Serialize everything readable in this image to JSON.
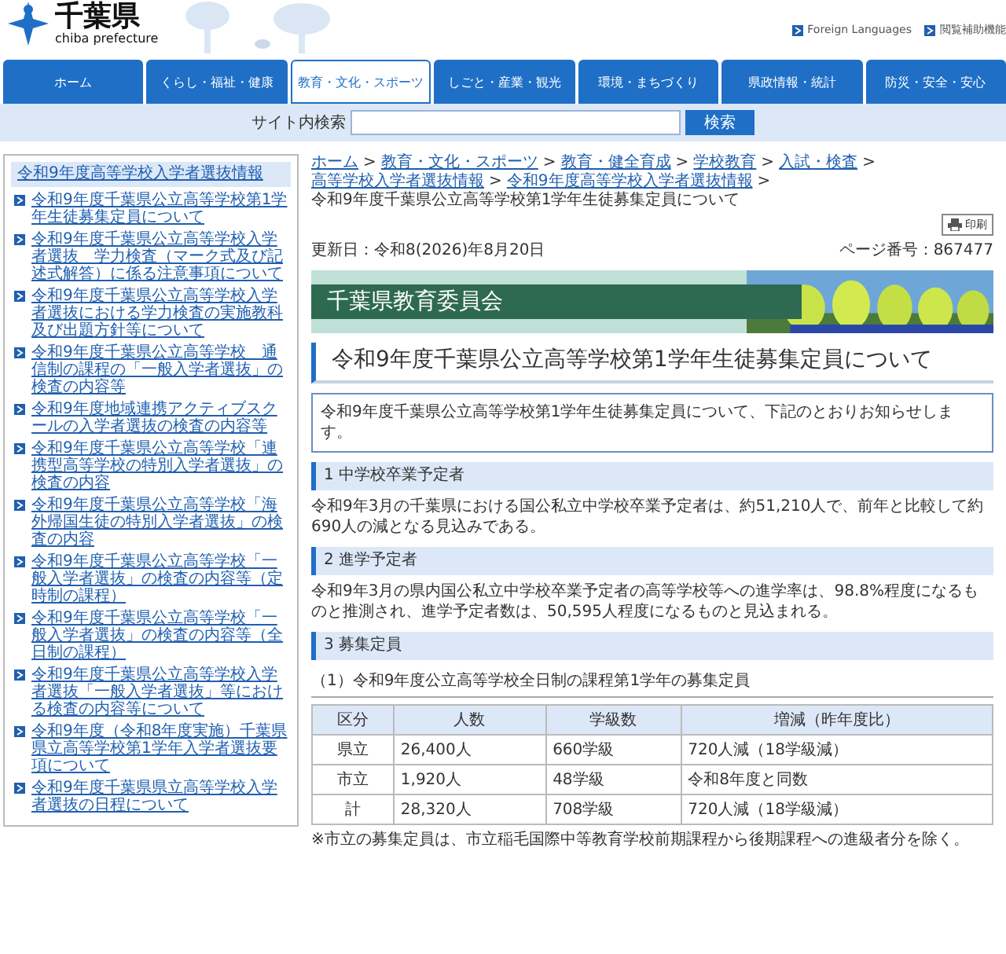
{
  "header": {
    "logo_title": "千葉県",
    "logo_subtitle": "chiba prefecture",
    "links": [
      "Foreign Languages",
      "閲覧補助機能"
    ]
  },
  "nav": [
    {
      "label": "ホーム",
      "selected": false
    },
    {
      "label": "くらし・福祉・健康",
      "selected": false
    },
    {
      "label": "教育・文化・スポーツ",
      "selected": true
    },
    {
      "label": "しごと・産業・観光",
      "selected": false
    },
    {
      "label": "環境・まちづくり",
      "selected": false
    },
    {
      "label": "県政情報・統計",
      "selected": false
    },
    {
      "label": "防災・安全・安心",
      "selected": false
    }
  ],
  "search": {
    "label": "サイト内検索",
    "button": "検索"
  },
  "sidebar": {
    "heading": "令和9年度高等学校入学者選抜情報",
    "items": [
      "令和9年度千葉県公立高等学校第1学年生徒募集定員について",
      "令和9年度千葉県公立高等学校入学者選抜　学力検査（マーク式及び記述式解答）に係る注意事項について",
      "令和9年度千葉県公立高等学校入学者選抜における学力検査の実施教科及び出題方針等について",
      "令和9年度千葉県公立高等学校　通信制の課程の「一般入学者選抜」の検査の内容等",
      "令和9年度地域連携アクティブスクールの入学者選抜の検査の内容等",
      "令和9年度千葉県公立高等学校「連携型高等学校の特別入学者選抜」の検査の内容",
      "令和9年度千葉県公立高等学校「海外帰国生徒の特別入学者選抜」の検査の内容",
      "令和9年度千葉県公立高等学校「一般入学者選抜」の検査の内容等（定時制の課程）",
      "令和9年度千葉県公立高等学校「一般入学者選抜」の検査の内容等（全日制の課程）",
      "令和9年度千葉県公立高等学校入学者選抜「一般入学者選抜」等における検査の内容等について",
      "令和9年度（令和8年度実施）千葉県県立高等学校第1学年入学者選抜要項について",
      "令和9年度千葉県県立高等学校入学者選抜の日程について"
    ]
  },
  "breadcrumb": [
    {
      "kind": "link",
      "label": "ホーム"
    },
    {
      "kind": "separator",
      "label": ">"
    },
    {
      "kind": "link",
      "label": "教育・文化・スポーツ"
    },
    {
      "kind": "separator",
      "label": ">"
    },
    {
      "kind": "link",
      "label": "教育・健全育成"
    },
    {
      "kind": "separator",
      "label": ">"
    },
    {
      "kind": "link",
      "label": "学校教育"
    },
    {
      "kind": "separator",
      "label": ">"
    },
    {
      "kind": "link",
      "label": "入試・検査"
    },
    {
      "kind": "separator",
      "label": ">"
    },
    {
      "kind": "link",
      "label": "高等学校入学者選抜情報"
    },
    {
      "kind": "separator",
      "label": ">"
    },
    {
      "kind": "link",
      "label": "令和9年度高等学校入学者選抜情報"
    },
    {
      "kind": "separator",
      "label": ">"
    },
    {
      "kind": "current",
      "label": "令和9年度千葉県公立高等学校第1学年生徒募集定員について"
    }
  ],
  "print_button": "印刷",
  "updated": "更新日：令和8(2026)年8月20日",
  "page_number": "ページ番号：867477",
  "banner": {
    "title": "千葉県教育委員会",
    "kind": "picture"
  },
  "title": "令和9年度千葉県公立高等学校第1学年生徒募集定員について",
  "notice": "令和9年度千葉県公立高等学校第1学年生徒募集定員について、下記のとおりお知らせします。",
  "sections": [
    {
      "heading": "1 中学校卒業予定者",
      "text": "令和9年3月の千葉県における国公私立中学校卒業予定者は、約51,210人で、前年と比較して約690人の減となる見込みである。"
    },
    {
      "heading": "2 進学予定者",
      "text": "令和9年3月の県内国公私立中学校卒業予定者の高等学校等への進学率は、98.8%程度になるものと推測され、進学予定者数は、50,595人程度になるものと見込まれる。"
    },
    {
      "heading": "3 募集定員"
    }
  ],
  "subheading": "（1）令和9年度公立高等学校全日制の課程第1学年の募集定員",
  "table": {
    "columns": [
      "区分",
      "人数",
      "学級数",
      "増減（昨年度比）"
    ],
    "rows": [
      [
        "県立",
        "26,400人",
        "660学級",
        "720人減（18学級減）"
      ],
      [
        "市立",
        "1,920人",
        "48学級",
        "令和8年度と同数"
      ],
      [
        "計",
        "28,320人",
        "708学級",
        "720人減（18学級減）"
      ]
    ]
  },
  "footnote": "※市立の募集定員は、市立稲毛国際中等教育学校前期課程から後期課程への進級者分を除く。"
}
